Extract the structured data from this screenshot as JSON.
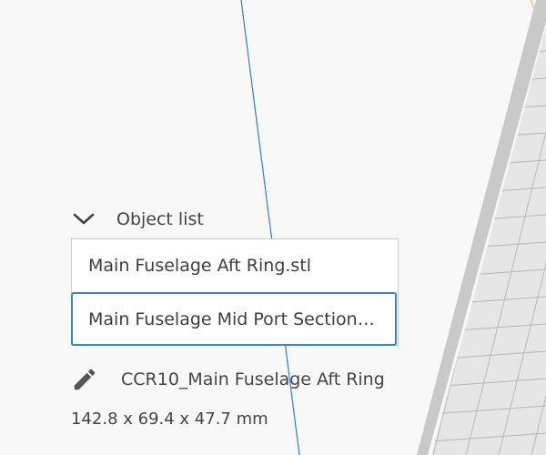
{
  "object_list": {
    "header_label": "Object list",
    "items": [
      {
        "label": "Main Fuselage Aft Ring.stl",
        "selected": false
      },
      {
        "label": "Main Fuselage Mid Port Section.stl",
        "selected": true
      }
    ]
  },
  "object_info": {
    "name": "CCR10_Main Fuselage Aft Ring",
    "dimensions": "142.8 x 69.4 x 47.7 mm"
  },
  "icons": {
    "collapse": "chevron-down-icon",
    "edit_name": "pencil-icon"
  },
  "colors": {
    "selection_border": "#3282d8",
    "background": "#f8f8f8",
    "axis_line": "#2a7fd4"
  }
}
